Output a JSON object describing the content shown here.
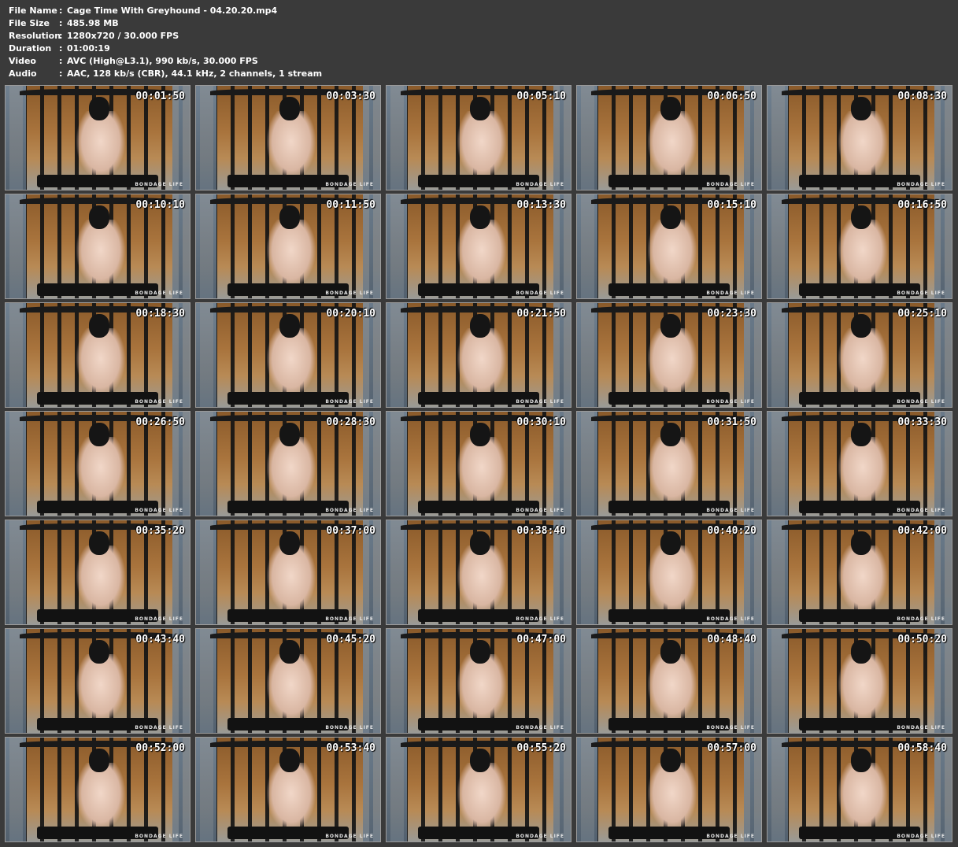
{
  "info": [
    {
      "key": "File Name",
      "value": "Cage Time With Greyhound - 04.20.20.mp4"
    },
    {
      "key": "File Size",
      "value": "485.98 MB"
    },
    {
      "key": "Resolution",
      "value": "1280x720 / 30.000 FPS"
    },
    {
      "key": "Duration",
      "value": "01:00:19"
    },
    {
      "key": "Video",
      "value": "AVC (High@L3.1), 990 kb/s, 30.000 FPS"
    },
    {
      "key": "Audio",
      "value": "AAC, 128 kb/s (CBR), 44.1 kHz, 2 channels, 1 stream"
    }
  ],
  "separator": ":",
  "watermark": "BONDAGE LIFE",
  "timestamps": [
    "00:01:50",
    "00:03:30",
    "00:05:10",
    "00:06:50",
    "00:08:30",
    "00:10:10",
    "00:11:50",
    "00:13:30",
    "00:15:10",
    "00:16:50",
    "00:18:30",
    "00:20:10",
    "00:21:50",
    "00:23:30",
    "00:25:10",
    "00:26:50",
    "00:28:30",
    "00:30:10",
    "00:31:50",
    "00:33:30",
    "00:35:20",
    "00:37:00",
    "00:38:40",
    "00:40:20",
    "00:42:00",
    "00:43:40",
    "00:45:20",
    "00:47:00",
    "00:48:40",
    "00:50:20",
    "00:52:00",
    "00:53:40",
    "00:55:20",
    "00:57:00",
    "00:58:40"
  ]
}
